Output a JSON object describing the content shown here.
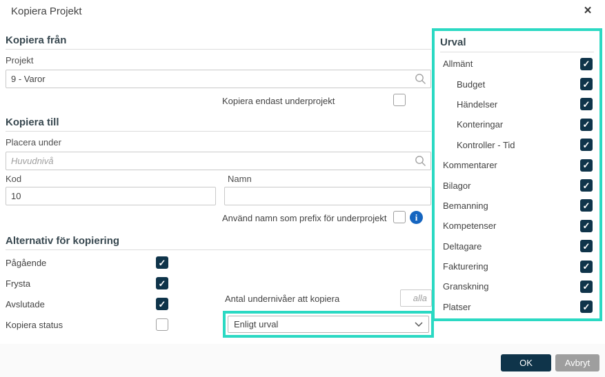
{
  "dialog": {
    "title": "Kopiera Projekt"
  },
  "icons": {
    "close_glyph": "×",
    "check_glyph": "✓",
    "info_glyph": "i"
  },
  "copy_from": {
    "header": "Kopiera från",
    "project_label": "Projekt",
    "project_value": "9 - Varor",
    "only_subprojects_label": "Kopiera endast underprojekt",
    "only_subprojects_checked": false
  },
  "copy_to": {
    "header": "Kopiera till",
    "place_under_label": "Placera under",
    "place_under_placeholder": "Huvudnivå",
    "code_label": "Kod",
    "code_value": "10",
    "name_label": "Namn",
    "name_value": "",
    "prefix_label": "Använd namn som prefix för underprojekt",
    "prefix_checked": false
  },
  "options": {
    "header": "Alternativ för kopiering",
    "statuses": [
      {
        "label": "Pågående",
        "checked": true
      },
      {
        "label": "Frysta",
        "checked": true
      },
      {
        "label": "Avslutade",
        "checked": true
      },
      {
        "label": "Kopiera status",
        "checked": false
      }
    ],
    "levels_label": "Antal undernivåer att kopiera",
    "levels_placeholder": "alla",
    "copy_mode_value": "Enligt urval"
  },
  "selection_panel": {
    "header": "Urval",
    "items": [
      {
        "label": "Allmänt",
        "indent": false,
        "checked": true
      },
      {
        "label": "Budget",
        "indent": true,
        "checked": true
      },
      {
        "label": "Händelser",
        "indent": true,
        "checked": true
      },
      {
        "label": "Konteringar",
        "indent": true,
        "checked": true
      },
      {
        "label": "Kontroller - Tid",
        "indent": true,
        "checked": true
      },
      {
        "label": "Kommentarer",
        "indent": false,
        "checked": true
      },
      {
        "label": "Bilagor",
        "indent": false,
        "checked": true
      },
      {
        "label": "Bemanning",
        "indent": false,
        "checked": true
      },
      {
        "label": "Kompetenser",
        "indent": false,
        "checked": true
      },
      {
        "label": "Deltagare",
        "indent": false,
        "checked": true
      },
      {
        "label": "Fakturering",
        "indent": false,
        "checked": true
      },
      {
        "label": "Granskning",
        "indent": false,
        "checked": true
      },
      {
        "label": "Platser",
        "indent": false,
        "checked": true
      }
    ]
  },
  "footer": {
    "ok_label": "OK",
    "cancel_label": "Avbryt"
  },
  "colors": {
    "accent_teal": "#2bd9c3",
    "primary_dark": "#0f344a",
    "cancel_gray": "#9e9e9e",
    "info_blue": "#1565c0"
  }
}
